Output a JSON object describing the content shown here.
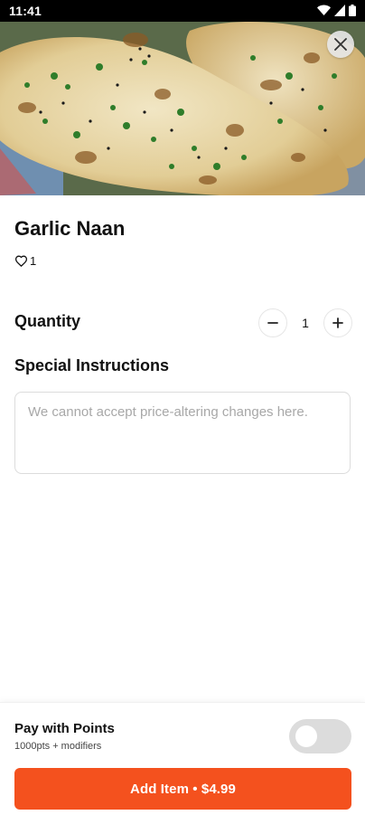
{
  "status_bar": {
    "time": "11:41"
  },
  "item": {
    "name": "Garlic Naan",
    "likes": "1"
  },
  "quantity": {
    "label": "Quantity",
    "value": "1",
    "decrement_icon": "minus-icon",
    "increment_icon": "plus-icon"
  },
  "instructions": {
    "label": "Special Instructions",
    "placeholder": "We cannot accept price-altering changes here."
  },
  "points": {
    "title": "Pay with Points",
    "subtitle": "1000pts + modifiers",
    "enabled": false
  },
  "add_button": {
    "label": "Add Item • $4.99"
  },
  "colors": {
    "accent": "#f4511e",
    "toggle_off": "#dcdcdc"
  }
}
